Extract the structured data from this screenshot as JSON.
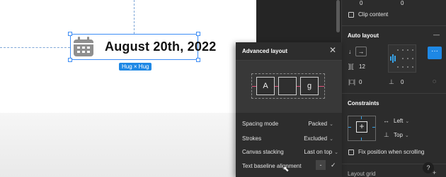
{
  "canvas": {
    "date_text": "August 20th, 2022",
    "hug_badge": "Hug × Hug",
    "icon": "calendar-icon"
  },
  "popup": {
    "title": "Advanced layout",
    "close_icon": "✕",
    "preview_cells": [
      "A",
      "",
      "g"
    ],
    "rows": [
      {
        "label": "Spacing mode",
        "value": "Packed"
      },
      {
        "label": "Strokes",
        "value": "Excluded"
      },
      {
        "label": "Canvas stacking",
        "value": "Last on top"
      },
      {
        "label": "Text baseline alignment",
        "value": ""
      }
    ],
    "baseline_minus": "-",
    "baseline_check": "✓"
  },
  "panel": {
    "top_value_1": "0",
    "top_value_2": "0",
    "clip_content": "Clip content",
    "auto_layout_title": "Auto layout",
    "auto_layout_remove": "—",
    "spacing_value": "12",
    "padding_value_1": "0",
    "padding_value_2": "0",
    "constraints_title": "Constraints",
    "constraint_h": "Left",
    "constraint_v": "Top",
    "fix_position": "Fix position when scrolling",
    "layout_grid": "Layout grid",
    "add_icon": "+",
    "help": "?"
  },
  "colors": {
    "accent": "#1e88e5",
    "selection": "#3d8df5",
    "baseline": "#e0507a"
  }
}
